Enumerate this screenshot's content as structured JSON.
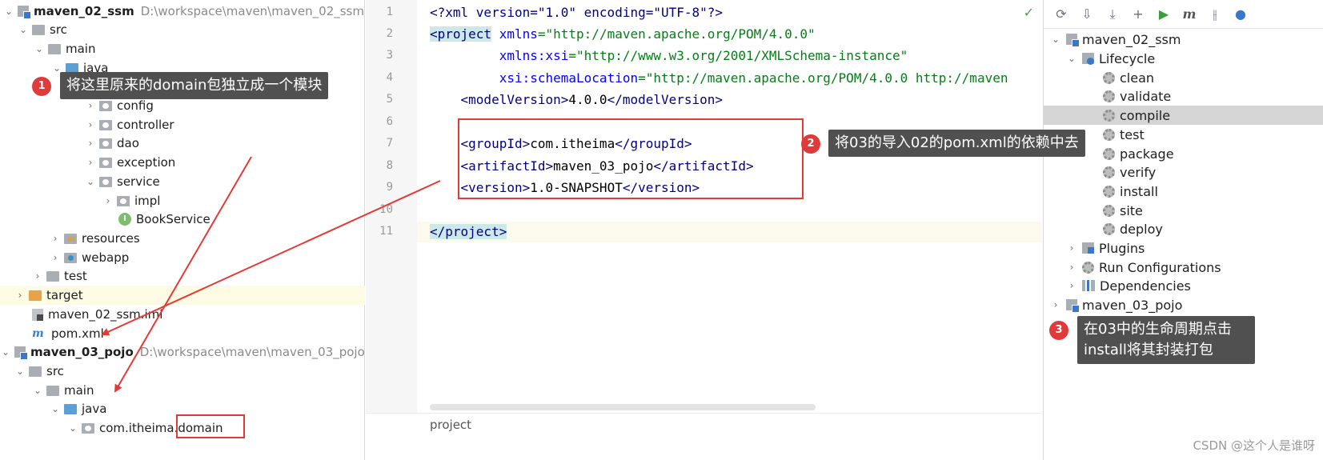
{
  "project_tree": {
    "module_02": {
      "name": "maven_02_ssm",
      "path": "D:\\workspace\\maven\\maven_02_ssm"
    },
    "src": "src",
    "main": "main",
    "java": "java",
    "config": "config",
    "controller": "controller",
    "dao": "dao",
    "exception": "exception",
    "service": "service",
    "impl": "impl",
    "book_service": "BookService",
    "book_service_icon_letter": "I",
    "resources": "resources",
    "webapp": "webapp",
    "test": "test",
    "target": "target",
    "iml_file": "maven_02_ssm.iml",
    "pom_file": "pom.xml",
    "pom_icon_letter": "m",
    "module_03": {
      "name": "maven_03_pojo",
      "path": "D:\\workspace\\maven\\maven_03_pojo"
    },
    "src_03": "src",
    "main_03": "main",
    "java_03": "java",
    "package_03": "com.itheima.",
    "package_03_highlight": "domain"
  },
  "editor": {
    "line_numbers": [
      "1",
      "2",
      "3",
      "4",
      "5",
      "6",
      "7",
      "8",
      "9",
      "10",
      "11"
    ],
    "xml_decl": "<?xml version=\"1.0\" encoding=\"UTF-8\"?>",
    "project_open": "<project",
    "xmlns": "xmlns",
    "xmlns_val": "=\"http://maven.apache.org/POM/4.0.0\"",
    "xmlns_xsi": "xmlns:xsi",
    "xmlns_xsi_val": "=\"http://www.w3.org/2001/XMLSchema-instance\"",
    "schema_loc": "xsi:schemaLocation",
    "schema_loc_val": "=\"http://maven.apache.org/POM/4.0.0 http://maven",
    "model_version_open": "<modelVersion>",
    "model_version": "4.0.0",
    "model_version_close": "</modelVersion>",
    "group_open": "<groupId>",
    "group_id": "com.itheima",
    "group_close": "</groupId>",
    "artifact_open": "<artifactId>",
    "artifact_id": "maven_03_pojo",
    "artifact_close": "</artifactId>",
    "version_open": "<version>",
    "version": "1.0-SNAPSHOT",
    "version_close": "</version>",
    "project_close": "</project>",
    "breadcrumb": "project",
    "check": "✓"
  },
  "maven": {
    "toolbar": {
      "reload": "⟳",
      "generate": "⇩",
      "download": "⤓",
      "add": "+",
      "run": "▶",
      "execute": "m",
      "toggle": "⫲",
      "more": "●"
    },
    "module_02": "maven_02_ssm",
    "lifecycle": "Lifecycle",
    "phases": [
      "clean",
      "validate",
      "compile",
      "test",
      "package",
      "verify",
      "install",
      "site",
      "deploy"
    ],
    "selected_phase": "compile",
    "plugins": "Plugins",
    "run_configurations": "Run Configurations",
    "dependencies": "Dependencies",
    "module_03": "maven_03_pojo"
  },
  "annotations": {
    "one": {
      "num": "1",
      "text": "将这里原来的domain包独立成一个模块"
    },
    "two": {
      "num": "2",
      "text": "将03的导入02的pom.xml的依赖中去"
    },
    "three": {
      "num": "3",
      "line1": "在03中的生命周期点击",
      "line2": "install将其封装打包"
    }
  },
  "watermark": "CSDN @这个人是谁呀",
  "colors": {
    "annotation": "#e53935",
    "callout_bg": "#505050",
    "selected_row": "#d5d5d5"
  }
}
